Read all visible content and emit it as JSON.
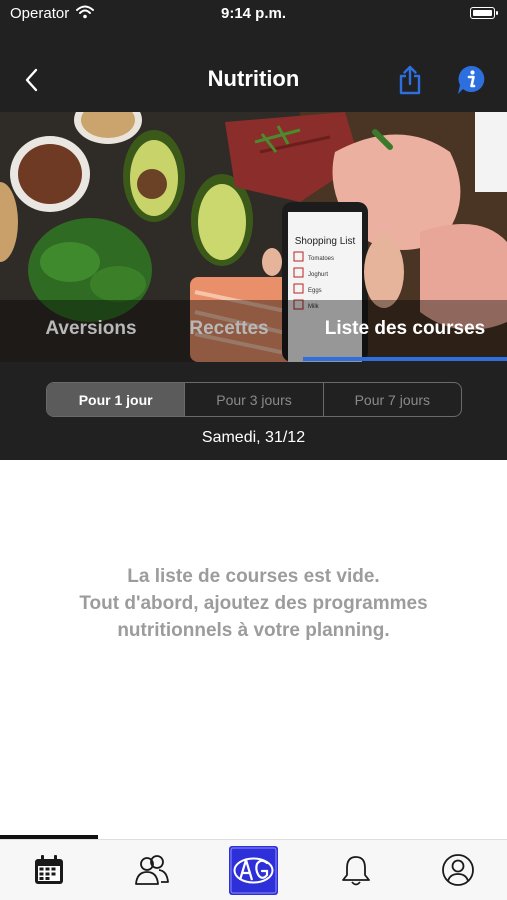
{
  "status_bar": {
    "carrier": "Operator",
    "time": "9:14 p.m."
  },
  "nav": {
    "title": "Nutrition",
    "back_icon": "chevron-left-icon",
    "share_icon": "share-icon",
    "info_icon": "info-icon"
  },
  "hero": {
    "phone_list": {
      "title": "Shopping List",
      "items": [
        "Tomatoes",
        "Joghurt",
        "Eggs",
        "Milk"
      ]
    }
  },
  "tabs": [
    {
      "label": "Aversions",
      "active": false
    },
    {
      "label": "Recettes",
      "active": false
    },
    {
      "label": "Liste des courses",
      "active": true
    }
  ],
  "period_filter": {
    "options": [
      {
        "label": "Pour 1 jour",
        "active": true
      },
      {
        "label": "Pour 3 jours",
        "active": false
      },
      {
        "label": "Pour 7 jours",
        "active": false
      }
    ]
  },
  "date": "Samedi, 31/12",
  "empty_state": {
    "lines": [
      "La liste de courses est vide.",
      "Tout d'abord, ajoutez des programmes",
      "nutritionnels à votre planning."
    ]
  },
  "tab_bar": {
    "items": [
      {
        "icon": "calendar-icon",
        "active": true
      },
      {
        "icon": "people-icon",
        "active": false
      },
      {
        "icon": "app-logo-icon",
        "active": false
      },
      {
        "icon": "bell-icon",
        "active": false
      },
      {
        "icon": "profile-icon",
        "active": false
      }
    ]
  },
  "colors": {
    "header_bg": "#212121",
    "accent": "#2e6fe0",
    "empty_text": "#9c9c9c",
    "segment_active": "#5b5b5b"
  }
}
